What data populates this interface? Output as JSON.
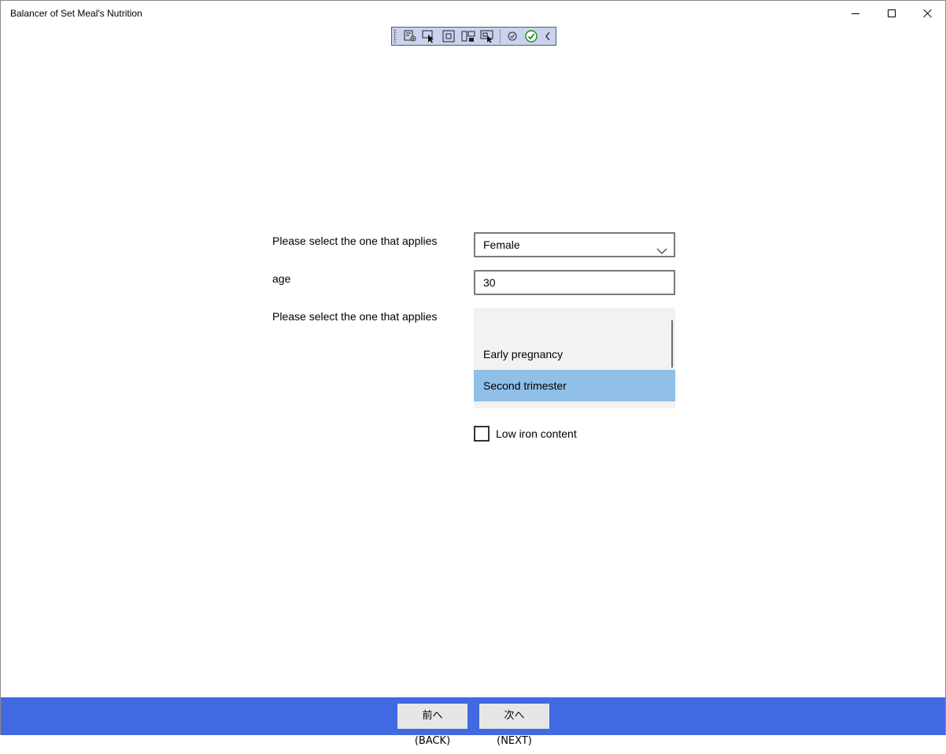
{
  "window": {
    "title": "Balancer of Set Meal's Nutrition"
  },
  "debug_toolbar": {
    "icons": [
      "live-visual-tree-icon",
      "select-element-icon",
      "display-layout-adorners-icon",
      "track-focus-icon",
      "preview-selection-icon",
      "binding-failures-icon",
      "hot-reload-ok-icon",
      "collapse-toolbar-icon"
    ]
  },
  "form": {
    "category_label": "Please select the one that applies",
    "category_value": "Female",
    "age_label": "age",
    "age_value": "30",
    "status_label": "Please select the one that applies",
    "status_options": [
      "",
      "Early pregnancy",
      "Second trimester"
    ],
    "status_selected": "Second trimester",
    "low_iron_label": "Low iron content",
    "low_iron_checked": false
  },
  "footer": {
    "back_label": "前へ(BACK)",
    "next_label": "次へ(NEXT)",
    "background_color": "#4169e1"
  },
  "colors": {
    "selected_item": "#90bfe8",
    "listbox_bg": "#f2f2f2"
  }
}
